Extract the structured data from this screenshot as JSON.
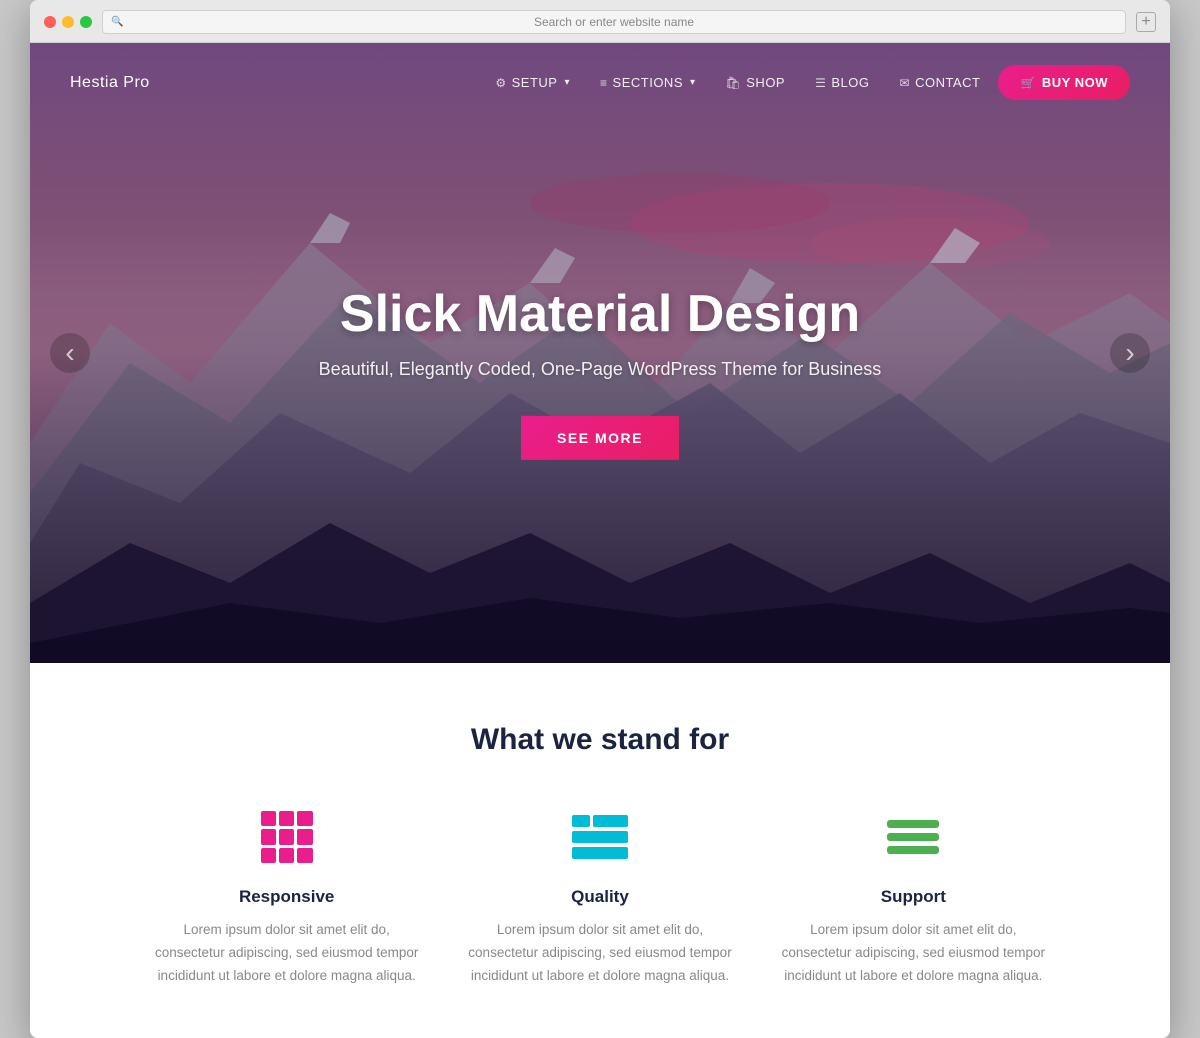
{
  "browser": {
    "address_placeholder": "Search or enter website name",
    "new_tab_label": "+"
  },
  "navbar": {
    "brand": "Hestia Pro",
    "nav_items": [
      {
        "id": "setup",
        "label": "SETUP",
        "icon": "⚙",
        "has_dropdown": true
      },
      {
        "id": "sections",
        "label": "SECTIONS",
        "icon": "≡",
        "has_dropdown": true
      },
      {
        "id": "shop",
        "label": "SHOP",
        "icon": "🛍"
      },
      {
        "id": "blog",
        "label": "BLOG",
        "icon": "☰"
      },
      {
        "id": "contact",
        "label": "CONTACT",
        "icon": "✉"
      }
    ],
    "buy_now_label": "BUY NOW"
  },
  "hero": {
    "title": "Slick Material Design",
    "subtitle": "Beautiful, Elegantly Coded, One-Page WordPress Theme for Business",
    "cta_label": "SEE MORE",
    "arrow_left": "‹",
    "arrow_right": "›"
  },
  "features": {
    "section_title": "What we stand for",
    "items": [
      {
        "id": "responsive",
        "name": "Responsive",
        "description": "Lorem ipsum dolor sit amet elit do, consectetur adipiscing, sed eiusmod tempor incididunt ut labore et dolore magna aliqua.",
        "icon_type": "grid",
        "color": "#e91e8c"
      },
      {
        "id": "quality",
        "name": "Quality",
        "description": "Lorem ipsum dolor sit amet elit do, consectetur adipiscing, sed eiusmod tempor incididunt ut labore et dolore magna aliqua.",
        "icon_type": "table",
        "color": "#00bcd4"
      },
      {
        "id": "support",
        "name": "Support",
        "description": "Lorem ipsum dolor sit amet elit do, consectetur adipiscing, sed eiusmod tempor incididunt ut labore et dolore magna aliqua.",
        "icon_type": "lines",
        "color": "#4caf50"
      }
    ]
  }
}
